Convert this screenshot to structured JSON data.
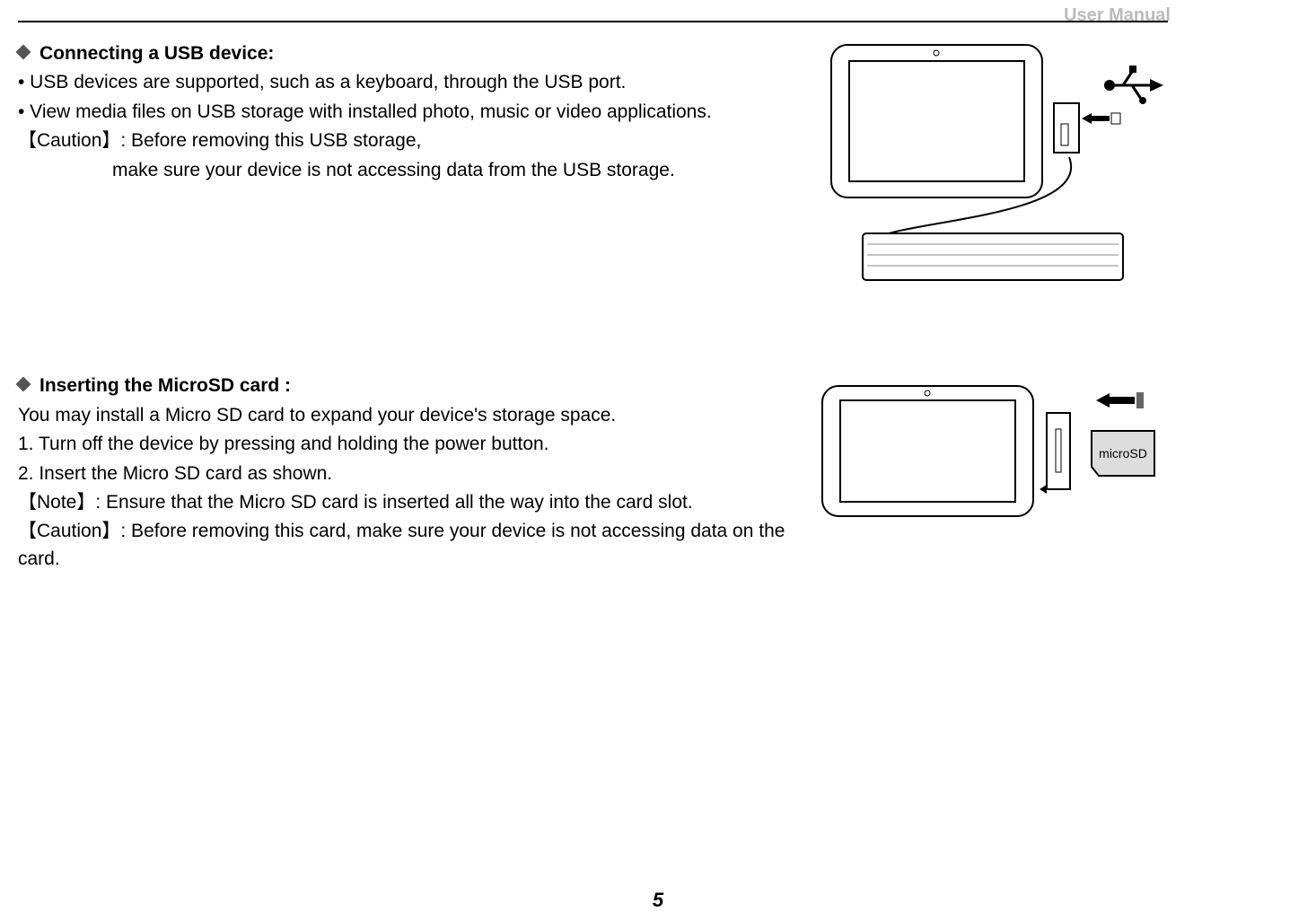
{
  "header": {
    "title": "User Manual"
  },
  "page_number": "5",
  "section1": {
    "heading": "Connecting a USB device:",
    "line1": "• USB devices are supported, such as a keyboard, through the USB port.",
    "line2": "• View media files on USB storage with installed photo, music or video applications.",
    "caution_label": "【Caution】",
    "caution_text1": ": Before removing this USB storage,",
    "caution_text2": "make sure your device is not accessing data from the USB storage."
  },
  "section2": {
    "heading": "Inserting the MicroSD card :",
    "line1": "You may install a Micro SD card to expand your device's storage space.",
    "line2": "1. Turn off the device by pressing and holding the power button.",
    "line3": "2. Insert the Micro SD card as shown.",
    "note_label": "【Note】",
    "note_text": ": Ensure that the Micro SD card is inserted all the way into the card slot.",
    "caution_label": "【Caution】",
    "caution_text": ": Before removing this card, make sure your device is not accessing data on the card.",
    "sd_label": "microSD"
  }
}
